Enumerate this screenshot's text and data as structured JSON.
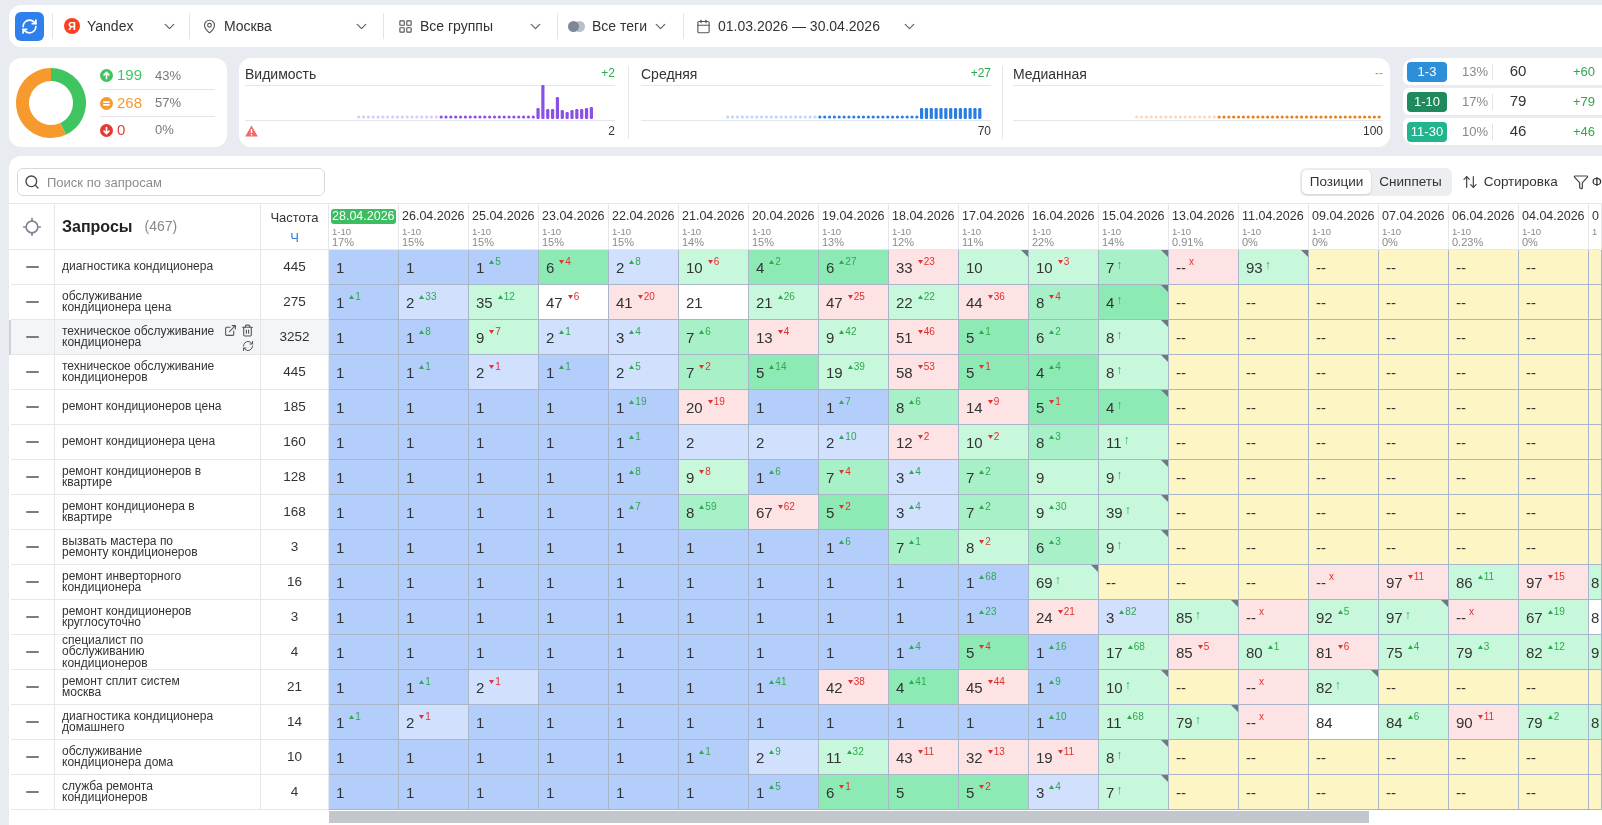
{
  "toolbar": {
    "filters": [
      {
        "kind": "engine",
        "label": "Yandex",
        "logo_letter": "Я"
      },
      {
        "kind": "region",
        "label": "Москва"
      },
      {
        "kind": "groups",
        "label": "Все группы"
      },
      {
        "kind": "tags",
        "label": "Все теги"
      },
      {
        "kind": "dates",
        "label": "01.03.2026 — 30.04.2026"
      }
    ]
  },
  "summary": {
    "chart_data": {
      "type": "donut",
      "values": [
        43,
        57,
        0
      ]
    },
    "legend": [
      {
        "kind": "up",
        "count": "199",
        "share": "43%",
        "color": "#3ec55f"
      },
      {
        "kind": "same",
        "count": "268",
        "share": "57%",
        "color": "#f79a2e"
      },
      {
        "kind": "down",
        "count": "0",
        "share": "0%",
        "color": "#e53935"
      }
    ]
  },
  "metrics": [
    {
      "title": "Видимость",
      "change": "+2",
      "kind": "up",
      "value": "2",
      "warning": true,
      "color": "#8b4fe6"
    },
    {
      "title": "Средняя",
      "change": "+27",
      "kind": "up",
      "value": "70",
      "warning": false,
      "color": "#2a7de1"
    },
    {
      "title": "Медианная",
      "change": "--",
      "kind": "none",
      "value": "100",
      "warning": false,
      "color": "#e8801a"
    }
  ],
  "ranges": [
    {
      "label": "1-3",
      "color": "#2e8fd9",
      "share": "13%",
      "count": "60",
      "change": "+60"
    },
    {
      "label": "1-10",
      "color": "#1f8a5b",
      "share": "17%",
      "count": "79",
      "change": "+79"
    },
    {
      "label": "11-30",
      "color": "#21b48d",
      "share": "10%",
      "count": "46",
      "change": "+46"
    }
  ],
  "table": {
    "search": {
      "placeholder": "Поиск по запросам"
    },
    "view_tabs": [
      {
        "label": "Позиции",
        "selected": true
      },
      {
        "label": "Сниппеты",
        "selected": false
      }
    ],
    "sort_label": "Сортировка",
    "filter_label": "Ф",
    "header": {
      "queries": "Запросы",
      "query_count": "(467)",
      "frequency": "Частота",
      "frequency_type": "Ч"
    },
    "dates": [
      {
        "date": "28.04.2026",
        "range": "1-10",
        "share": "17%",
        "selected": true
      },
      {
        "date": "26.04.2026",
        "range": "1-10",
        "share": "15%",
        "selected": false
      },
      {
        "date": "25.04.2026",
        "range": "1-10",
        "share": "15%",
        "selected": false
      },
      {
        "date": "23.04.2026",
        "range": "1-10",
        "share": "15%",
        "selected": false
      },
      {
        "date": "22.04.2026",
        "range": "1-10",
        "share": "15%",
        "selected": false
      },
      {
        "date": "21.04.2026",
        "range": "1-10",
        "share": "14%",
        "selected": false
      },
      {
        "date": "20.04.2026",
        "range": "1-10",
        "share": "15%",
        "selected": false
      },
      {
        "date": "19.04.2026",
        "range": "1-10",
        "share": "13%",
        "selected": false
      },
      {
        "date": "18.04.2026",
        "range": "1-10",
        "share": "12%",
        "selected": false
      },
      {
        "date": "17.04.2026",
        "range": "1-10",
        "share": "11%",
        "selected": false
      },
      {
        "date": "16.04.2026",
        "range": "1-10",
        "share": "22%",
        "selected": false
      },
      {
        "date": "15.04.2026",
        "range": "1-10",
        "share": "14%",
        "selected": false
      },
      {
        "date": "13.04.2026",
        "range": "1-10",
        "share": "0.91%",
        "selected": false
      },
      {
        "date": "11.04.2026",
        "range": "1-10",
        "share": "0%",
        "selected": false
      },
      {
        "date": "09.04.2026",
        "range": "1-10",
        "share": "0%",
        "selected": false
      },
      {
        "date": "07.04.2026",
        "range": "1-10",
        "share": "0%",
        "selected": false
      },
      {
        "date": "06.04.2026",
        "range": "1-10",
        "share": "0.23%",
        "selected": false
      },
      {
        "date": "04.04.2026",
        "range": "1-10",
        "share": "0%",
        "selected": false
      },
      {
        "date": "0",
        "range": "1",
        "selected": false
      }
    ],
    "rows": [
      {
        "query": "диагностика кондиционера",
        "frequency": "445",
        "highlighted": false,
        "cells": [
          {
            "value": "1",
            "color": "#b4cefb"
          },
          {
            "value": "1",
            "color": "#b4cefb"
          },
          {
            "value": "1",
            "change": "5",
            "kind": "up",
            "color": "#b4cefb"
          },
          {
            "value": "6",
            "change": "4",
            "kind": "down",
            "color": "#8eeab5"
          },
          {
            "value": "2",
            "change": "8",
            "kind": "up",
            "color": "#d0e0fd"
          },
          {
            "value": "10",
            "change": "6",
            "kind": "down",
            "color": "#c8f8dc"
          },
          {
            "value": "4",
            "change": "2",
            "kind": "up",
            "color": "#8eeab5"
          },
          {
            "value": "6",
            "change": "27",
            "kind": "up",
            "color": "#8eeab5"
          },
          {
            "value": "33",
            "change": "23",
            "kind": "down",
            "color": "#fde3e3"
          },
          {
            "value": "10",
            "color": "#c8f8dc",
            "corner": true
          },
          {
            "value": "10",
            "change": "3",
            "kind": "down",
            "color": "#c8f8dc"
          },
          {
            "value": "7",
            "change": "↑",
            "kind": "new",
            "color": "#a8f0c8",
            "corner": true
          },
          {
            "value": "--",
            "change": "x",
            "kind": "lost",
            "color": "#fde3e3"
          },
          {
            "value": "93",
            "change": "↑",
            "kind": "new",
            "color": "#c8f8dc",
            "corner": true
          },
          {
            "value": "--",
            "color": "#fdf5c4"
          },
          {
            "value": "--",
            "color": "#fdf5c4"
          },
          {
            "value": "--",
            "color": "#fdf5c4"
          },
          {
            "value": "--",
            "color": "#fdf5c4"
          },
          {
            "color": "#fdf5c4"
          }
        ]
      },
      {
        "query": "обслуживание кондиционера цена",
        "frequency": "275",
        "highlighted": false,
        "cells": [
          {
            "value": "1",
            "change": "1",
            "kind": "up",
            "color": "#b4cefb"
          },
          {
            "value": "2",
            "change": "33",
            "kind": "up",
            "color": "#d0e0fd"
          },
          {
            "value": "35",
            "change": "12",
            "kind": "up",
            "color": "#c8f8dc"
          },
          {
            "value": "47",
            "change": "6",
            "kind": "down",
            "color": "#ffffff"
          },
          {
            "value": "41",
            "change": "20",
            "kind": "down",
            "color": "#fde3e3"
          },
          {
            "value": "21",
            "color": "#ffffff"
          },
          {
            "value": "21",
            "change": "26",
            "kind": "up",
            "color": "#c8f8dc"
          },
          {
            "value": "47",
            "change": "25",
            "kind": "down",
            "color": "#fde3e3"
          },
          {
            "value": "22",
            "change": "22",
            "kind": "up",
            "color": "#c8f8dc"
          },
          {
            "value": "44",
            "change": "36",
            "kind": "down",
            "color": "#fde3e3"
          },
          {
            "value": "8",
            "change": "4",
            "kind": "down",
            "color": "#a8f0c8"
          },
          {
            "value": "4",
            "change": "↑",
            "kind": "new",
            "color": "#8eeab5",
            "corner": true
          },
          {
            "value": "--",
            "color": "#fdf5c4"
          },
          {
            "value": "--",
            "color": "#fdf5c4"
          },
          {
            "value": "--",
            "color": "#fdf5c4"
          },
          {
            "value": "--",
            "color": "#fdf5c4"
          },
          {
            "value": "--",
            "color": "#fdf5c4"
          },
          {
            "value": "--",
            "color": "#fdf5c4"
          },
          {
            "color": "#fdf5c4"
          }
        ]
      },
      {
        "query": "техническое обслуживание кондиционера",
        "frequency": "3252",
        "highlighted": true,
        "cells": [
          {
            "value": "1",
            "color": "#b4cefb"
          },
          {
            "value": "1",
            "change": "8",
            "kind": "up",
            "color": "#b4cefb"
          },
          {
            "value": "9",
            "change": "7",
            "kind": "down",
            "color": "#c8f8dc"
          },
          {
            "value": "2",
            "change": "1",
            "kind": "up",
            "color": "#d0e0fd"
          },
          {
            "value": "3",
            "change": "4",
            "kind": "up",
            "color": "#d0e0fd"
          },
          {
            "value": "7",
            "change": "6",
            "kind": "up",
            "color": "#a8f0c8"
          },
          {
            "value": "13",
            "change": "4",
            "kind": "down",
            "color": "#fde3e3"
          },
          {
            "value": "9",
            "change": "42",
            "kind": "up",
            "color": "#c8f8dc"
          },
          {
            "value": "51",
            "change": "46",
            "kind": "down",
            "color": "#fde3e3"
          },
          {
            "value": "5",
            "change": "1",
            "kind": "up",
            "color": "#8eeab5"
          },
          {
            "value": "6",
            "change": "2",
            "kind": "up",
            "color": "#a8f0c8"
          },
          {
            "value": "8",
            "change": "↑",
            "kind": "new",
            "color": "#c8f8dc",
            "corner": true
          },
          {
            "value": "--",
            "color": "#fdf5c4"
          },
          {
            "value": "--",
            "color": "#fdf5c4"
          },
          {
            "value": "--",
            "color": "#fdf5c4"
          },
          {
            "value": "--",
            "color": "#fdf5c4"
          },
          {
            "value": "--",
            "color": "#fdf5c4"
          },
          {
            "value": "--",
            "color": "#fdf5c4"
          },
          {
            "color": "#fdf5c4"
          }
        ]
      },
      {
        "query": "техническое обслуживание кондиционеров",
        "frequency": "445",
        "highlighted": false,
        "cells": [
          {
            "value": "1",
            "color": "#b4cefb"
          },
          {
            "value": "1",
            "change": "1",
            "kind": "up",
            "color": "#b4cefb"
          },
          {
            "value": "2",
            "change": "1",
            "kind": "down",
            "color": "#d0e0fd"
          },
          {
            "value": "1",
            "change": "1",
            "kind": "up",
            "color": "#b4cefb"
          },
          {
            "value": "2",
            "change": "5",
            "kind": "up",
            "color": "#d0e0fd"
          },
          {
            "value": "7",
            "change": "2",
            "kind": "down",
            "color": "#a8f0c8"
          },
          {
            "value": "5",
            "change": "14",
            "kind": "up",
            "color": "#8eeab5"
          },
          {
            "value": "19",
            "change": "39",
            "kind": "up",
            "color": "#c8f8dc"
          },
          {
            "value": "58",
            "change": "53",
            "kind": "down",
            "color": "#fde3e3"
          },
          {
            "value": "5",
            "change": "1",
            "kind": "down",
            "color": "#8eeab5"
          },
          {
            "value": "4",
            "change": "4",
            "kind": "up",
            "color": "#8eeab5"
          },
          {
            "value": "8",
            "change": "↑",
            "kind": "new",
            "color": "#c8f8dc",
            "corner": true
          },
          {
            "value": "--",
            "color": "#fdf5c4"
          },
          {
            "value": "--",
            "color": "#fdf5c4"
          },
          {
            "value": "--",
            "color": "#fdf5c4"
          },
          {
            "value": "--",
            "color": "#fdf5c4"
          },
          {
            "value": "--",
            "color": "#fdf5c4"
          },
          {
            "value": "--",
            "color": "#fdf5c4"
          },
          {
            "color": "#fdf5c4"
          }
        ]
      },
      {
        "query": "ремонт кондиционеров цена",
        "frequency": "185",
        "highlighted": false,
        "cells": [
          {
            "value": "1",
            "color": "#b4cefb"
          },
          {
            "value": "1",
            "color": "#b4cefb"
          },
          {
            "value": "1",
            "color": "#b4cefb"
          },
          {
            "value": "1",
            "color": "#b4cefb"
          },
          {
            "value": "1",
            "change": "19",
            "kind": "up",
            "color": "#b4cefb"
          },
          {
            "value": "20",
            "change": "19",
            "kind": "down",
            "color": "#fde3e3"
          },
          {
            "value": "1",
            "color": "#b4cefb"
          },
          {
            "value": "1",
            "change": "7",
            "kind": "up",
            "color": "#b4cefb"
          },
          {
            "value": "8",
            "change": "6",
            "kind": "up",
            "color": "#a8f0c8"
          },
          {
            "value": "14",
            "change": "9",
            "kind": "down",
            "color": "#fde3e3"
          },
          {
            "value": "5",
            "change": "1",
            "kind": "down",
            "color": "#8eeab5"
          },
          {
            "value": "4",
            "change": "↑",
            "kind": "new",
            "color": "#8eeab5",
            "corner": true
          },
          {
            "value": "--",
            "color": "#fdf5c4"
          },
          {
            "value": "--",
            "color": "#fdf5c4"
          },
          {
            "value": "--",
            "color": "#fdf5c4"
          },
          {
            "value": "--",
            "color": "#fdf5c4"
          },
          {
            "value": "--",
            "color": "#fdf5c4"
          },
          {
            "value": "--",
            "color": "#fdf5c4"
          },
          {
            "color": "#fdf5c4"
          }
        ]
      },
      {
        "query": "ремонт кондиционера цена",
        "frequency": "160",
        "highlighted": false,
        "cells": [
          {
            "value": "1",
            "color": "#b4cefb"
          },
          {
            "value": "1",
            "color": "#b4cefb"
          },
          {
            "value": "1",
            "color": "#b4cefb"
          },
          {
            "value": "1",
            "color": "#b4cefb"
          },
          {
            "value": "1",
            "change": "1",
            "kind": "up",
            "color": "#b4cefb"
          },
          {
            "value": "2",
            "color": "#d0e0fd"
          },
          {
            "value": "2",
            "color": "#d0e0fd"
          },
          {
            "value": "2",
            "change": "10",
            "kind": "up",
            "color": "#d0e0fd"
          },
          {
            "value": "12",
            "change": "2",
            "kind": "down",
            "color": "#fde3e3"
          },
          {
            "value": "10",
            "change": "2",
            "kind": "down",
            "color": "#c8f8dc"
          },
          {
            "value": "8",
            "change": "3",
            "kind": "up",
            "color": "#a8f0c8"
          },
          {
            "value": "11",
            "change": "↑",
            "kind": "new",
            "color": "#c8f8dc"
          },
          {
            "value": "--",
            "color": "#fdf5c4"
          },
          {
            "value": "--",
            "color": "#fdf5c4"
          },
          {
            "value": "--",
            "color": "#fdf5c4"
          },
          {
            "value": "--",
            "color": "#fdf5c4"
          },
          {
            "value": "--",
            "color": "#fdf5c4"
          },
          {
            "value": "--",
            "color": "#fdf5c4"
          },
          {
            "color": "#fdf5c4"
          }
        ]
      },
      {
        "query": "ремонт кондиционеров в квартире",
        "frequency": "128",
        "highlighted": false,
        "cells": [
          {
            "value": "1",
            "color": "#b4cefb"
          },
          {
            "value": "1",
            "color": "#b4cefb"
          },
          {
            "value": "1",
            "color": "#b4cefb"
          },
          {
            "value": "1",
            "color": "#b4cefb"
          },
          {
            "value": "1",
            "change": "8",
            "kind": "up",
            "color": "#b4cefb"
          },
          {
            "value": "9",
            "change": "8",
            "kind": "down",
            "color": "#c8f8dc"
          },
          {
            "value": "1",
            "change": "6",
            "kind": "up",
            "color": "#b4cefb"
          },
          {
            "value": "7",
            "change": "4",
            "kind": "down",
            "color": "#a8f0c8"
          },
          {
            "value": "3",
            "change": "4",
            "kind": "up",
            "color": "#d0e0fd"
          },
          {
            "value": "7",
            "change": "2",
            "kind": "up",
            "color": "#a8f0c8"
          },
          {
            "value": "9",
            "color": "#c8f8dc"
          },
          {
            "value": "9",
            "change": "↑",
            "kind": "new",
            "color": "#c8f8dc",
            "corner": true
          },
          {
            "value": "--",
            "color": "#fdf5c4"
          },
          {
            "value": "--",
            "color": "#fdf5c4"
          },
          {
            "value": "--",
            "color": "#fdf5c4"
          },
          {
            "value": "--",
            "color": "#fdf5c4"
          },
          {
            "value": "--",
            "color": "#fdf5c4"
          },
          {
            "value": "--",
            "color": "#fdf5c4"
          },
          {
            "color": "#fdf5c4"
          }
        ]
      },
      {
        "query": "ремонт кондиционера в квартире",
        "frequency": "168",
        "highlighted": false,
        "cells": [
          {
            "value": "1",
            "color": "#b4cefb"
          },
          {
            "value": "1",
            "color": "#b4cefb"
          },
          {
            "value": "1",
            "color": "#b4cefb"
          },
          {
            "value": "1",
            "color": "#b4cefb"
          },
          {
            "value": "1",
            "change": "7",
            "kind": "up",
            "color": "#b4cefb"
          },
          {
            "value": "8",
            "change": "59",
            "kind": "up",
            "color": "#a8f0c8"
          },
          {
            "value": "67",
            "change": "62",
            "kind": "down",
            "color": "#fde3e3"
          },
          {
            "value": "5",
            "change": "2",
            "kind": "down",
            "color": "#8eeab5"
          },
          {
            "value": "3",
            "change": "4",
            "kind": "up",
            "color": "#d0e0fd"
          },
          {
            "value": "7",
            "change": "2",
            "kind": "up",
            "color": "#a8f0c8"
          },
          {
            "value": "9",
            "change": "30",
            "kind": "up",
            "color": "#c8f8dc"
          },
          {
            "value": "39",
            "change": "↑",
            "kind": "new",
            "color": "#c8f8dc",
            "corner": true
          },
          {
            "value": "--",
            "color": "#fdf5c4"
          },
          {
            "value": "--",
            "color": "#fdf5c4"
          },
          {
            "value": "--",
            "color": "#fdf5c4"
          },
          {
            "value": "--",
            "color": "#fdf5c4"
          },
          {
            "value": "--",
            "color": "#fdf5c4"
          },
          {
            "value": "--",
            "color": "#fdf5c4"
          },
          {
            "color": "#fdf5c4"
          }
        ]
      },
      {
        "query": "вызвать мастера по ремонту кондиционеров",
        "frequency": "3",
        "highlighted": false,
        "cells": [
          {
            "value": "1",
            "color": "#b4cefb"
          },
          {
            "value": "1",
            "color": "#b4cefb"
          },
          {
            "value": "1",
            "color": "#b4cefb"
          },
          {
            "value": "1",
            "color": "#b4cefb"
          },
          {
            "value": "1",
            "color": "#b4cefb"
          },
          {
            "value": "1",
            "color": "#b4cefb"
          },
          {
            "value": "1",
            "color": "#b4cefb"
          },
          {
            "value": "1",
            "change": "6",
            "kind": "up",
            "color": "#b4cefb"
          },
          {
            "value": "7",
            "change": "1",
            "kind": "up",
            "color": "#a8f0c8"
          },
          {
            "value": "8",
            "change": "2",
            "kind": "down",
            "color": "#c8f8dc"
          },
          {
            "value": "6",
            "change": "3",
            "kind": "up",
            "color": "#a8f0c8"
          },
          {
            "value": "9",
            "change": "↑",
            "kind": "new",
            "color": "#c8f8dc",
            "corner": true
          },
          {
            "value": "--",
            "color": "#fdf5c4"
          },
          {
            "value": "--",
            "color": "#fdf5c4"
          },
          {
            "value": "--",
            "color": "#fdf5c4"
          },
          {
            "value": "--",
            "color": "#fdf5c4"
          },
          {
            "value": "--",
            "color": "#fdf5c4"
          },
          {
            "value": "--",
            "color": "#fdf5c4"
          },
          {
            "color": "#fdf5c4"
          }
        ]
      },
      {
        "query": "ремонт инверторного кондиционера",
        "frequency": "16",
        "highlighted": false,
        "cells": [
          {
            "value": "1",
            "color": "#b4cefb"
          },
          {
            "value": "1",
            "color": "#b4cefb"
          },
          {
            "value": "1",
            "color": "#b4cefb"
          },
          {
            "value": "1",
            "color": "#b4cefb"
          },
          {
            "value": "1",
            "color": "#b4cefb"
          },
          {
            "value": "1",
            "color": "#b4cefb"
          },
          {
            "value": "1",
            "color": "#b4cefb"
          },
          {
            "value": "1",
            "color": "#b4cefb"
          },
          {
            "value": "1",
            "color": "#b4cefb"
          },
          {
            "value": "1",
            "change": "68",
            "kind": "up",
            "color": "#b4cefb"
          },
          {
            "value": "69",
            "change": "↑",
            "kind": "new",
            "color": "#c8f8dc",
            "corner": true
          },
          {
            "value": "--",
            "color": "#fdf5c4"
          },
          {
            "value": "--",
            "color": "#fdf5c4"
          },
          {
            "value": "--",
            "color": "#fdf5c4"
          },
          {
            "value": "--",
            "change": "x",
            "kind": "lost",
            "color": "#fde3e3"
          },
          {
            "value": "97",
            "change": "11",
            "kind": "down",
            "color": "#fde3e3"
          },
          {
            "value": "86",
            "change": "11",
            "kind": "up",
            "color": "#c8f8dc"
          },
          {
            "value": "97",
            "change": "15",
            "kind": "down",
            "color": "#fde3e3"
          },
          {
            "value": "8",
            "color": "#c8f8dc"
          }
        ]
      },
      {
        "query": "ремонт кондиционеров круглосуточно",
        "frequency": "3",
        "highlighted": false,
        "cells": [
          {
            "value": "1",
            "color": "#b4cefb"
          },
          {
            "value": "1",
            "color": "#b4cefb"
          },
          {
            "value": "1",
            "color": "#b4cefb"
          },
          {
            "value": "1",
            "color": "#b4cefb"
          },
          {
            "value": "1",
            "color": "#b4cefb"
          },
          {
            "value": "1",
            "color": "#b4cefb"
          },
          {
            "value": "1",
            "color": "#b4cefb"
          },
          {
            "value": "1",
            "color": "#b4cefb"
          },
          {
            "value": "1",
            "color": "#b4cefb"
          },
          {
            "value": "1",
            "change": "23",
            "kind": "up",
            "color": "#b4cefb"
          },
          {
            "value": "24",
            "change": "21",
            "kind": "down",
            "color": "#fde3e3"
          },
          {
            "value": "3",
            "change": "82",
            "kind": "up",
            "color": "#d0e0fd"
          },
          {
            "value": "85",
            "change": "↑",
            "kind": "new",
            "color": "#c8f8dc",
            "corner": true
          },
          {
            "value": "--",
            "change": "x",
            "kind": "lost",
            "color": "#fde3e3"
          },
          {
            "value": "92",
            "change": "5",
            "kind": "up",
            "color": "#c8f8dc"
          },
          {
            "value": "97",
            "change": "↑",
            "kind": "new",
            "color": "#c8f8dc",
            "corner": true
          },
          {
            "value": "--",
            "change": "x",
            "kind": "lost",
            "color": "#fde3e3"
          },
          {
            "value": "67",
            "change": "19",
            "kind": "up",
            "color": "#c8f8dc"
          },
          {
            "value": "8",
            "color": "#ffffff"
          }
        ]
      },
      {
        "query": "специалист по обслуживанию кондиционеров",
        "frequency": "4",
        "highlighted": false,
        "cells": [
          {
            "value": "1",
            "color": "#b4cefb"
          },
          {
            "value": "1",
            "color": "#b4cefb"
          },
          {
            "value": "1",
            "color": "#b4cefb"
          },
          {
            "value": "1",
            "color": "#b4cefb"
          },
          {
            "value": "1",
            "color": "#b4cefb"
          },
          {
            "value": "1",
            "color": "#b4cefb"
          },
          {
            "value": "1",
            "color": "#b4cefb"
          },
          {
            "value": "1",
            "color": "#b4cefb"
          },
          {
            "value": "1",
            "change": "4",
            "kind": "up",
            "color": "#b4cefb"
          },
          {
            "value": "5",
            "change": "4",
            "kind": "down",
            "color": "#8eeab5"
          },
          {
            "value": "1",
            "change": "16",
            "kind": "up",
            "color": "#b4cefb"
          },
          {
            "value": "17",
            "change": "68",
            "kind": "up",
            "color": "#c8f8dc"
          },
          {
            "value": "85",
            "change": "5",
            "kind": "down",
            "color": "#fde3e3"
          },
          {
            "value": "80",
            "change": "1",
            "kind": "up",
            "color": "#c8f8dc"
          },
          {
            "value": "81",
            "change": "6",
            "kind": "down",
            "color": "#fde3e3"
          },
          {
            "value": "75",
            "change": "4",
            "kind": "up",
            "color": "#c8f8dc"
          },
          {
            "value": "79",
            "change": "3",
            "kind": "up",
            "color": "#c8f8dc"
          },
          {
            "value": "82",
            "change": "12",
            "kind": "up",
            "color": "#c8f8dc"
          },
          {
            "value": "9",
            "color": "#c8f8dc"
          }
        ]
      },
      {
        "query": "ремонт сплит систем москва",
        "frequency": "21",
        "highlighted": false,
        "cells": [
          {
            "value": "1",
            "color": "#b4cefb"
          },
          {
            "value": "1",
            "change": "1",
            "kind": "up",
            "color": "#b4cefb"
          },
          {
            "value": "2",
            "change": "1",
            "kind": "down",
            "color": "#d0e0fd"
          },
          {
            "value": "1",
            "color": "#b4cefb"
          },
          {
            "value": "1",
            "color": "#b4cefb"
          },
          {
            "value": "1",
            "color": "#b4cefb"
          },
          {
            "value": "1",
            "change": "41",
            "kind": "up",
            "color": "#b4cefb"
          },
          {
            "value": "42",
            "change": "38",
            "kind": "down",
            "color": "#fde3e3"
          },
          {
            "value": "4",
            "change": "41",
            "kind": "up",
            "color": "#8eeab5"
          },
          {
            "value": "45",
            "change": "44",
            "kind": "down",
            "color": "#fde3e3"
          },
          {
            "value": "1",
            "change": "9",
            "kind": "up",
            "color": "#b4cefb"
          },
          {
            "value": "10",
            "change": "↑",
            "kind": "new",
            "color": "#c8f8dc",
            "corner": true
          },
          {
            "value": "--",
            "color": "#fdf5c4"
          },
          {
            "value": "--",
            "change": "x",
            "kind": "lost",
            "color": "#fde3e3"
          },
          {
            "value": "82",
            "change": "↑",
            "kind": "new",
            "color": "#c8f8dc",
            "corner": true
          },
          {
            "value": "--",
            "color": "#fdf5c4"
          },
          {
            "value": "--",
            "color": "#fdf5c4"
          },
          {
            "value": "--",
            "color": "#fdf5c4"
          },
          {
            "color": "#fdf5c4"
          }
        ]
      },
      {
        "query": "диагностика кондиционера домашнего",
        "frequency": "14",
        "highlighted": false,
        "cells": [
          {
            "value": "1",
            "change": "1",
            "kind": "up",
            "color": "#b4cefb"
          },
          {
            "value": "2",
            "change": "1",
            "kind": "down",
            "color": "#d0e0fd"
          },
          {
            "value": "1",
            "color": "#b4cefb"
          },
          {
            "value": "1",
            "color": "#b4cefb"
          },
          {
            "value": "1",
            "color": "#b4cefb"
          },
          {
            "value": "1",
            "color": "#b4cefb"
          },
          {
            "value": "1",
            "color": "#b4cefb"
          },
          {
            "value": "1",
            "color": "#b4cefb"
          },
          {
            "value": "1",
            "color": "#b4cefb"
          },
          {
            "value": "1",
            "color": "#b4cefb"
          },
          {
            "value": "1",
            "change": "10",
            "kind": "up",
            "color": "#b4cefb"
          },
          {
            "value": "11",
            "change": "68",
            "kind": "up",
            "color": "#c8f8dc"
          },
          {
            "value": "79",
            "change": "↑",
            "kind": "new",
            "color": "#c8f8dc",
            "corner": true
          },
          {
            "value": "--",
            "change": "x",
            "kind": "lost",
            "color": "#fde3e3"
          },
          {
            "value": "84",
            "color": "#ffffff"
          },
          {
            "value": "84",
            "change": "6",
            "kind": "up",
            "color": "#c8f8dc"
          },
          {
            "value": "90",
            "change": "11",
            "kind": "down",
            "color": "#fde3e3"
          },
          {
            "value": "79",
            "change": "2",
            "kind": "up",
            "color": "#c8f8dc"
          },
          {
            "value": "8",
            "color": "#c8f8dc"
          }
        ]
      },
      {
        "query": "обслуживание кондиционера дома",
        "frequency": "10",
        "highlighted": false,
        "cells": [
          {
            "value": "1",
            "color": "#b4cefb"
          },
          {
            "value": "1",
            "color": "#b4cefb"
          },
          {
            "value": "1",
            "color": "#b4cefb"
          },
          {
            "value": "1",
            "color": "#b4cefb"
          },
          {
            "value": "1",
            "color": "#b4cefb"
          },
          {
            "value": "1",
            "change": "1",
            "kind": "up",
            "color": "#b4cefb"
          },
          {
            "value": "2",
            "change": "9",
            "kind": "up",
            "color": "#d0e0fd"
          },
          {
            "value": "11",
            "change": "32",
            "kind": "up",
            "color": "#c8f8dc"
          },
          {
            "value": "43",
            "change": "11",
            "kind": "down",
            "color": "#fde3e3"
          },
          {
            "value": "32",
            "change": "13",
            "kind": "down",
            "color": "#fde3e3"
          },
          {
            "value": "19",
            "change": "11",
            "kind": "down",
            "color": "#fde3e3"
          },
          {
            "value": "8",
            "change": "↑",
            "kind": "new",
            "color": "#c8f8dc",
            "corner": true
          },
          {
            "value": "--",
            "color": "#fdf5c4"
          },
          {
            "value": "--",
            "color": "#fdf5c4"
          },
          {
            "value": "--",
            "color": "#fdf5c4"
          },
          {
            "value": "--",
            "color": "#fdf5c4"
          },
          {
            "value": "--",
            "color": "#fdf5c4"
          },
          {
            "value": "--",
            "color": "#fdf5c4"
          },
          {
            "color": "#fdf5c4"
          }
        ]
      },
      {
        "query": "служба ремонта кондиционеров",
        "frequency": "4",
        "highlighted": false,
        "cells": [
          {
            "value": "1",
            "color": "#b4cefb"
          },
          {
            "value": "1",
            "color": "#b4cefb"
          },
          {
            "value": "1",
            "color": "#b4cefb"
          },
          {
            "value": "1",
            "color": "#b4cefb"
          },
          {
            "value": "1",
            "color": "#b4cefb"
          },
          {
            "value": "1",
            "color": "#b4cefb"
          },
          {
            "value": "1",
            "change": "5",
            "kind": "up",
            "color": "#b4cefb"
          },
          {
            "value": "6",
            "change": "1",
            "kind": "down",
            "color": "#8eeab5"
          },
          {
            "value": "5",
            "color": "#8eeab5"
          },
          {
            "value": "5",
            "change": "2",
            "kind": "down",
            "color": "#8eeab5"
          },
          {
            "value": "3",
            "change": "4",
            "kind": "up",
            "color": "#d0e0fd"
          },
          {
            "value": "7",
            "change": "↑",
            "kind": "new",
            "color": "#c8f8dc",
            "corner": true
          },
          {
            "value": "--",
            "color": "#fdf5c4"
          },
          {
            "value": "--",
            "color": "#fdf5c4"
          },
          {
            "value": "--",
            "color": "#fdf5c4"
          },
          {
            "value": "--",
            "color": "#fdf5c4"
          },
          {
            "value": "--",
            "color": "#fdf5c4"
          },
          {
            "value": "--",
            "color": "#fdf5c4"
          },
          {
            "color": "#fdf5c4"
          }
        ]
      }
    ]
  }
}
